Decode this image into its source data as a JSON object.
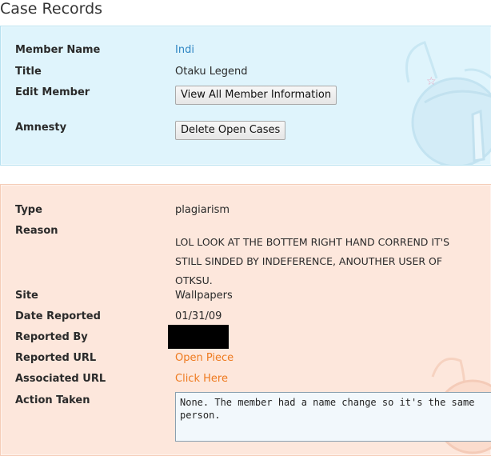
{
  "page": {
    "title": "Case Records"
  },
  "member": {
    "member_name_label": "Member Name",
    "member_name_value": "Indi",
    "title_label": "Title",
    "title_value": "Otaku Legend",
    "edit_member_label": "Edit Member",
    "edit_member_button": "View All Member Information",
    "amnesty_label": "Amnesty",
    "amnesty_button": "Delete Open Cases"
  },
  "case": {
    "type_label": "Type",
    "type_value": "plagiarism",
    "reason_label": "Reason",
    "reason_value": "LOL LOOK AT THE BOTTEM RIGHT HAND CORREND IT'S STILL SINDED BY INDEFERENCE, ANOUTHER USER OF OTKSU.",
    "site_label": "Site",
    "site_value": "Wallpapers",
    "date_reported_label": "Date Reported",
    "date_reported_value": "01/31/09",
    "reported_by_label": "Reported By",
    "reported_url_label": "Reported URL",
    "reported_url_value": "Open Piece",
    "associated_url_label": "Associated URL",
    "associated_url_value": "Click Here",
    "action_taken_label": "Action Taken",
    "action_taken_value": "None. The member had a name change so it's the same person."
  },
  "colors": {
    "member_panel_bg": "#dff4fc",
    "case_panel_bg": "#fde7dc",
    "link_blue": "#2f86c4",
    "link_orange": "#ee7a1f"
  }
}
